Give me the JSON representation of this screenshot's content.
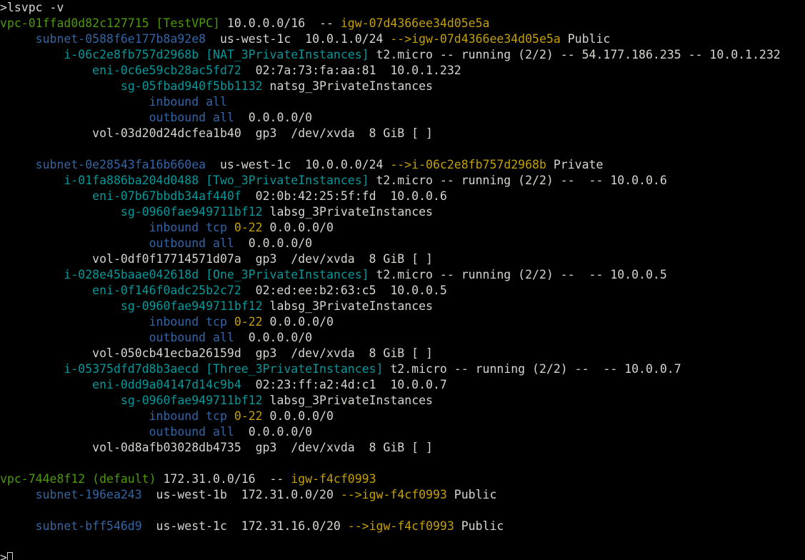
{
  "colors": {
    "background": "#000000",
    "default": "#d3d7cf",
    "green": "#4e9a06",
    "blue": "#3465a4",
    "cyan": "#06989a",
    "yellow": "#c4a000"
  },
  "terminal": {
    "prompt_command": ">lsvpc -v",
    "cursor_prompt": ">",
    "lines": [
      [
        {
          "t": ">lsvpc -v",
          "c": "default"
        }
      ],
      [
        {
          "t": "vpc-01ffad0d82c127715 [TestVPC]",
          "c": "green"
        },
        {
          "t": " 10.0.0.0/16  -- ",
          "c": "default"
        },
        {
          "t": "igw-07d4366ee34d05e5a",
          "c": "yellow"
        }
      ],
      [
        {
          "t": "     ",
          "c": "default"
        },
        {
          "t": "subnet-0588f6e177b8a92e8",
          "c": "blue"
        },
        {
          "t": "  us-west-1c  10.0.1.0/24 ",
          "c": "default"
        },
        {
          "t": "-->igw-07d4366ee34d05e5a",
          "c": "yellow"
        },
        {
          "t": " Public",
          "c": "default"
        }
      ],
      [
        {
          "t": "         ",
          "c": "default"
        },
        {
          "t": "i-06c2e8fb757d2968b [NAT_3PrivateInstances]",
          "c": "cyan"
        },
        {
          "t": " t2.micro -- running (2/2) -- 54.177.186.235 -- 10.0.1.232",
          "c": "default"
        }
      ],
      [
        {
          "t": "             ",
          "c": "default"
        },
        {
          "t": "eni-0c6e59cb28ac5fd72",
          "c": "cyan"
        },
        {
          "t": "  02:7a:73:fa:aa:81  10.0.1.232",
          "c": "default"
        }
      ],
      [
        {
          "t": "                 ",
          "c": "default"
        },
        {
          "t": "sg-05fbad940f5bb1132",
          "c": "cyan"
        },
        {
          "t": " natsg_3PrivateInstances",
          "c": "default"
        }
      ],
      [
        {
          "t": "                     ",
          "c": "default"
        },
        {
          "t": "inbound all",
          "c": "blue"
        }
      ],
      [
        {
          "t": "                     ",
          "c": "default"
        },
        {
          "t": "outbound all",
          "c": "blue"
        },
        {
          "t": "  0.0.0.0/0",
          "c": "default"
        }
      ],
      [
        {
          "t": "             vol-03d20d24dcfea1b40  gp3  /dev/xvda  8 GiB [ ]",
          "c": "default"
        }
      ],
      [
        {
          "t": "",
          "c": "default"
        }
      ],
      [
        {
          "t": "     ",
          "c": "default"
        },
        {
          "t": "subnet-0e28543fa16b660ea",
          "c": "blue"
        },
        {
          "t": "  us-west-1c  10.0.0.0/24 ",
          "c": "default"
        },
        {
          "t": "-->i-06c2e8fb757d2968b",
          "c": "yellow"
        },
        {
          "t": " Private",
          "c": "default"
        }
      ],
      [
        {
          "t": "         ",
          "c": "default"
        },
        {
          "t": "i-01fa886ba204d0488 [Two_3PrivateInstances]",
          "c": "cyan"
        },
        {
          "t": " t2.micro -- running (2/2) --  -- 10.0.0.6",
          "c": "default"
        }
      ],
      [
        {
          "t": "             ",
          "c": "default"
        },
        {
          "t": "eni-07b67bbdb34af440f",
          "c": "cyan"
        },
        {
          "t": "  02:0b:42:25:5f:fd  10.0.0.6",
          "c": "default"
        }
      ],
      [
        {
          "t": "                 ",
          "c": "default"
        },
        {
          "t": "sg-0960fae949711bf12",
          "c": "cyan"
        },
        {
          "t": " labsg_3PrivateInstances",
          "c": "default"
        }
      ],
      [
        {
          "t": "                     ",
          "c": "default"
        },
        {
          "t": "inbound tcp",
          "c": "blue"
        },
        {
          "t": " ",
          "c": "default"
        },
        {
          "t": "0-22",
          "c": "yellow"
        },
        {
          "t": " 0.0.0.0/0",
          "c": "default"
        }
      ],
      [
        {
          "t": "                     ",
          "c": "default"
        },
        {
          "t": "outbound all",
          "c": "blue"
        },
        {
          "t": "  0.0.0.0/0",
          "c": "default"
        }
      ],
      [
        {
          "t": "             vol-0df0f17714571d07a  gp3  /dev/xvda  8 GiB [ ]",
          "c": "default"
        }
      ],
      [
        {
          "t": "         ",
          "c": "default"
        },
        {
          "t": "i-028e45baae042618d [One_3PrivateInstances]",
          "c": "cyan"
        },
        {
          "t": " t2.micro -- running (2/2) --  -- 10.0.0.5",
          "c": "default"
        }
      ],
      [
        {
          "t": "             ",
          "c": "default"
        },
        {
          "t": "eni-0f146f0adc25b2c72",
          "c": "cyan"
        },
        {
          "t": "  02:ed:ee:b2:63:c5  10.0.0.5",
          "c": "default"
        }
      ],
      [
        {
          "t": "                 ",
          "c": "default"
        },
        {
          "t": "sg-0960fae949711bf12",
          "c": "cyan"
        },
        {
          "t": " labsg_3PrivateInstances",
          "c": "default"
        }
      ],
      [
        {
          "t": "                     ",
          "c": "default"
        },
        {
          "t": "inbound tcp",
          "c": "blue"
        },
        {
          "t": " ",
          "c": "default"
        },
        {
          "t": "0-22",
          "c": "yellow"
        },
        {
          "t": " 0.0.0.0/0",
          "c": "default"
        }
      ],
      [
        {
          "t": "                     ",
          "c": "default"
        },
        {
          "t": "outbound all",
          "c": "blue"
        },
        {
          "t": "  0.0.0.0/0",
          "c": "default"
        }
      ],
      [
        {
          "t": "             vol-050cb41ecba26159d  gp3  /dev/xvda  8 GiB [ ]",
          "c": "default"
        }
      ],
      [
        {
          "t": "         ",
          "c": "default"
        },
        {
          "t": "i-05375dfd7d8b3aecd [Three_3PrivateInstances]",
          "c": "cyan"
        },
        {
          "t": " t2.micro -- running (2/2) --  -- 10.0.0.7",
          "c": "default"
        }
      ],
      [
        {
          "t": "             ",
          "c": "default"
        },
        {
          "t": "eni-0dd9a04147d14c9b4",
          "c": "cyan"
        },
        {
          "t": "  02:23:ff:a2:4d:c1  10.0.0.7",
          "c": "default"
        }
      ],
      [
        {
          "t": "                 ",
          "c": "default"
        },
        {
          "t": "sg-0960fae949711bf12",
          "c": "cyan"
        },
        {
          "t": " labsg_3PrivateInstances",
          "c": "default"
        }
      ],
      [
        {
          "t": "                     ",
          "c": "default"
        },
        {
          "t": "inbound tcp",
          "c": "blue"
        },
        {
          "t": " ",
          "c": "default"
        },
        {
          "t": "0-22",
          "c": "yellow"
        },
        {
          "t": " 0.0.0.0/0",
          "c": "default"
        }
      ],
      [
        {
          "t": "                     ",
          "c": "default"
        },
        {
          "t": "outbound all",
          "c": "blue"
        },
        {
          "t": "  0.0.0.0/0",
          "c": "default"
        }
      ],
      [
        {
          "t": "             vol-0d8afb03028db4735  gp3  /dev/xvda  8 GiB [ ]",
          "c": "default"
        }
      ],
      [
        {
          "t": "",
          "c": "default"
        }
      ],
      [
        {
          "t": "vpc-744e8f12 (default)",
          "c": "green"
        },
        {
          "t": " 172.31.0.0/16  -- ",
          "c": "default"
        },
        {
          "t": "igw-f4cf0993",
          "c": "yellow"
        }
      ],
      [
        {
          "t": "     ",
          "c": "default"
        },
        {
          "t": "subnet-196ea243",
          "c": "blue"
        },
        {
          "t": "  us-west-1b  172.31.0.0/20 ",
          "c": "default"
        },
        {
          "t": "-->igw-f4cf0993",
          "c": "yellow"
        },
        {
          "t": " Public",
          "c": "default"
        }
      ],
      [
        {
          "t": "",
          "c": "default"
        }
      ],
      [
        {
          "t": "     ",
          "c": "default"
        },
        {
          "t": "subnet-bff546d9",
          "c": "blue"
        },
        {
          "t": "  us-west-1c  172.31.16.0/20 ",
          "c": "default"
        },
        {
          "t": "-->igw-f4cf0993",
          "c": "yellow"
        },
        {
          "t": " Public",
          "c": "default"
        }
      ],
      [
        {
          "t": "",
          "c": "default"
        }
      ]
    ]
  }
}
